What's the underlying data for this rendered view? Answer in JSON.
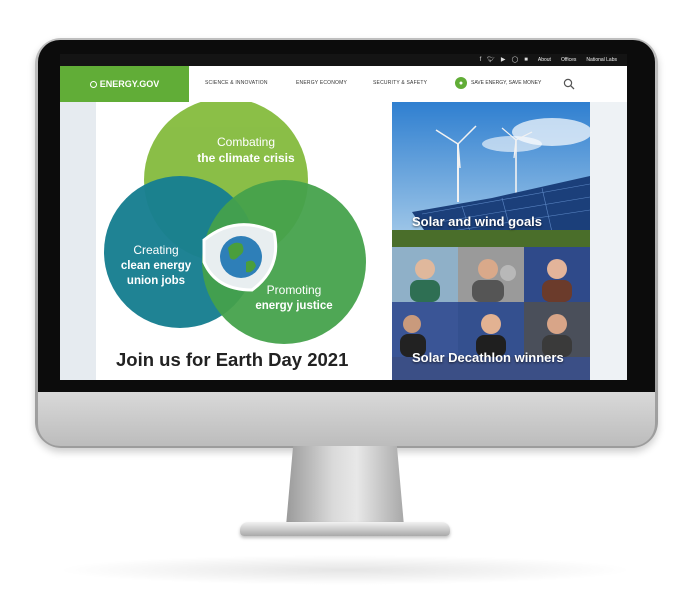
{
  "utility_bar": {
    "social_icons": [
      "facebook-icon",
      "twitter-icon",
      "youtube-icon",
      "instagram-icon",
      "linkedin-icon"
    ],
    "links": [
      "About",
      "Offices",
      "National Labs"
    ]
  },
  "header": {
    "logo_text": "ENERGY.GOV",
    "nav": [
      "SCIENCE & INNOVATION",
      "ENERGY ECONOMY",
      "SECURITY & SAFETY"
    ],
    "save_label": "SAVE ENERGY, SAVE MONEY"
  },
  "hero": {
    "circle_top": {
      "line1": "Combating",
      "line2": "the climate crisis"
    },
    "circle_left": {
      "line1": "Creating",
      "line2": "clean energy",
      "line3": "union jobs"
    },
    "circle_right": {
      "line1": "Promoting",
      "line2": "energy justice"
    },
    "caption": "Join us for Earth Day 2021"
  },
  "tiles": [
    {
      "label": "Solar and wind goals"
    },
    {
      "label": "Solar Decathlon winners"
    }
  ],
  "colors": {
    "brand_green": "#61ad37",
    "circle_top": "#86bc40",
    "circle_left": "#0e7a8c",
    "circle_right": "#3e9e45"
  }
}
